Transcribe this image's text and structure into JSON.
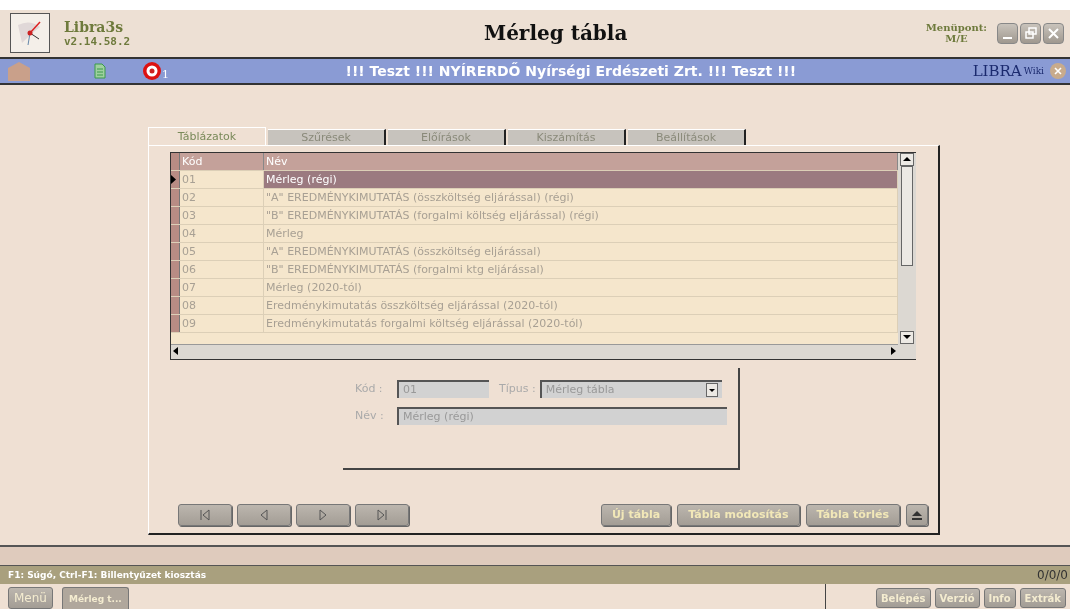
{
  "app": {
    "name": "Libra3s",
    "version": "v2.14.58.2"
  },
  "window": {
    "title": "Mérleg tábla",
    "menu_label": "Menüpont:",
    "menu_code": "M/E"
  },
  "banner": {
    "badge_count": "1",
    "text": "!!! Teszt !!! NYÍRERDŐ Nyírségi Erdészeti Zrt. !!! Teszt !!!",
    "logo": "LIBRA",
    "logo_suffix": "Wiki"
  },
  "tabs": [
    {
      "label": "Táblázatok",
      "selected": true
    },
    {
      "label": "Szűrések",
      "selected": false
    },
    {
      "label": "Előírások",
      "selected": false
    },
    {
      "label": "Kiszámítás",
      "selected": false
    },
    {
      "label": "Beállítások",
      "selected": false
    }
  ],
  "table": {
    "columns": [
      "Kód",
      "Név"
    ],
    "rows": [
      {
        "code": "01",
        "name": "Mérleg (régi)",
        "selected": true
      },
      {
        "code": "02",
        "name": "\"A\" EREDMÉNYKIMUTATÁS (összköltség eljárással) (régi)",
        "selected": false
      },
      {
        "code": "03",
        "name": "\"B\" EREDMÉNYKIMUTATÁS (forgalmi költség eljárással) (régi)",
        "selected": false
      },
      {
        "code": "04",
        "name": "Mérleg",
        "selected": false
      },
      {
        "code": "05",
        "name": "\"A\" EREDMÉNYKIMUTATÁS (összköltség eljárással)",
        "selected": false
      },
      {
        "code": "06",
        "name": "\"B\" EREDMÉNYKIMUTATÁS (forgalmi ktg eljárással)",
        "selected": false
      },
      {
        "code": "07",
        "name": "Mérleg (2020-tól)",
        "selected": false
      },
      {
        "code": "08",
        "name": "Eredménykimutatás összköltség eljárással (2020-tól)",
        "selected": false
      },
      {
        "code": "09",
        "name": "Eredménykimutatás forgalmi költség eljárással (2020-tól)",
        "selected": false
      }
    ]
  },
  "form": {
    "disabled": true,
    "code_label": "Kód :",
    "code_value": "01",
    "type_label": "Típus :",
    "type_value": "Mérleg tábla",
    "name_label": "Név :",
    "name_value": "Mérleg (régi)"
  },
  "actions": [
    "Új tábla",
    "Tábla módosítás",
    "Tábla törlés"
  ],
  "status_bar": {
    "hint": "F1: Súgó, Ctrl-F1: Billentyűzet kiosztás",
    "counter": "0/0/0"
  },
  "taskbar": {
    "menu": "Menü",
    "tasks": [
      {
        "label": "Mérleg t...",
        "selected": true
      }
    ],
    "buttons": [
      "Belépés",
      "Verzió",
      "Info",
      "Extrák"
    ]
  }
}
